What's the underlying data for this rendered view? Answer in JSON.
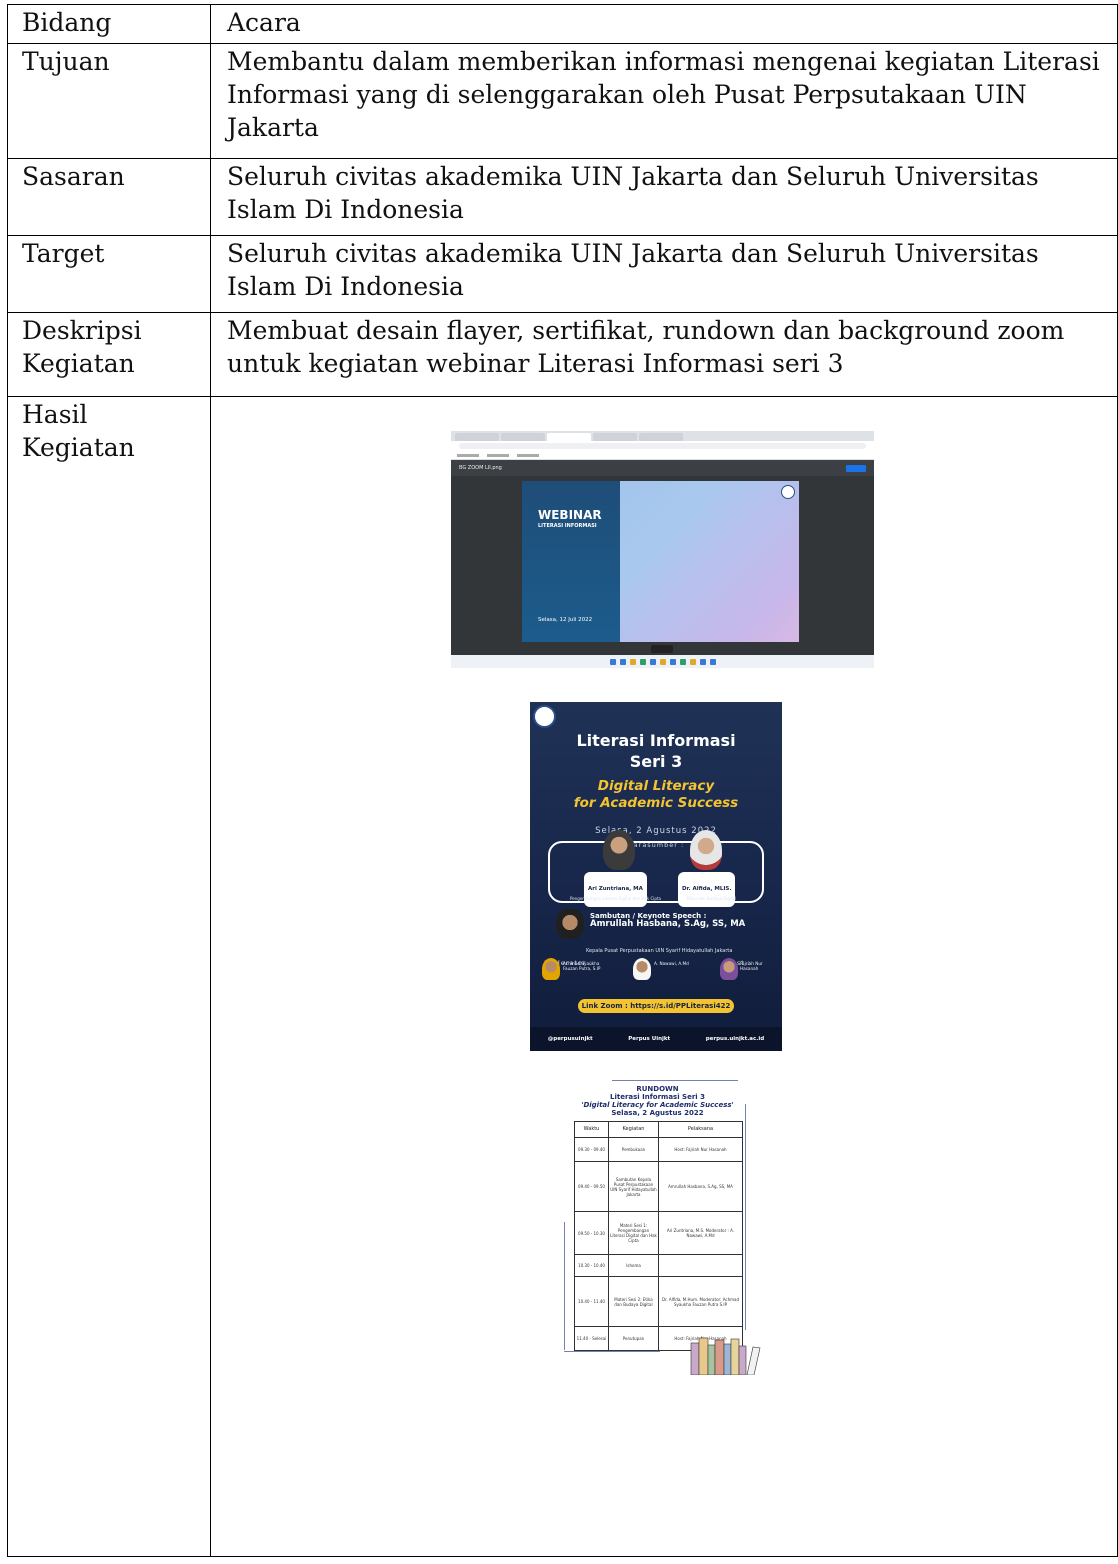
{
  "rows": [
    {
      "label": "Bidang",
      "value": "Acara"
    },
    {
      "label": "Tujuan",
      "value": "Membantu dalam memberikan informasi mengenai kegiatan Literasi Informasi yang di selenggarakan oleh Pusat Perpsutakaan UIN Jakarta"
    },
    {
      "label": "Sasaran",
      "value": "Seluruh civitas akademika UIN Jakarta dan Seluruh Universitas Islam Di Indonesia"
    },
    {
      "label": "Target",
      "value": "Seluruh civitas akademika UIN Jakarta dan Seluruh Universitas Islam Di Indonesia"
    },
    {
      "label": "Deskripsi Kegiatan",
      "value": "Membuat desain flayer,  sertifikat, rundown dan background zoom untuk kegiatan webinar Literasi Informasi seri 3"
    },
    {
      "label": "Hasil Kegiatan",
      "value": ""
    }
  ],
  "screenshot": {
    "file_name": "BG ZOOM LII.png",
    "slide_title": "WEBINAR",
    "slide_subtitle": "LITERASI INFORMASI",
    "slide_date": "Selasa, 12 Juli 2022"
  },
  "poster": {
    "title_line1": "Literasi Informasi",
    "title_line2": "Seri 3",
    "theme_line1": "Digital Literacy",
    "theme_line2": "for Academic Success",
    "date": "Selasa, 2 Agustus 2022",
    "narasumber_label": "Narasumber :",
    "speaker1_name": "Ari Zuntriana, MA",
    "speaker1_role": "Pengembangan Literasi Digital dan Hak Cipta",
    "speaker2_name": "Dr. Alfida, MLIS.",
    "speaker2_role": "Etika dan Budaya Digital",
    "keynote_label": "Sambutan / Keynote Speech :",
    "keynote_name": "Amrullah Hasbana, S.Ag, SS, MA",
    "keynote_role": "Kepala Pusat Perpustakaan UIN Syarif Hidayatullah Jakarta",
    "moderator_label": "Moderator :",
    "host_label": "Host :",
    "moderator1": "Achmad Syaukha Fauzan Putra, S.IP",
    "moderator2": "A. Nawawi, A.Md",
    "host": "Fajriah Nur Hasanah",
    "zoom_link": "Link Zoom : https://s.id/PPLiterasi422",
    "social_handle": "@perpusuinjkt",
    "facebook": "Perpus Uinjkt",
    "website": "perpus.uinjkt.ac.id"
  },
  "rundown": {
    "heading": "RUNDOWN",
    "title": "Literasi Informasi Seri 3",
    "theme": "'Digital Literacy for Academic Success'",
    "date": "Selasa, 2 Agustus 2022",
    "columns": [
      "Waktu",
      "Kegiatan",
      "Pelaksana"
    ],
    "rows": [
      [
        "09.30 - 09.40",
        "Pembukaan",
        "Host: Fajriah Nur Hasanah"
      ],
      [
        "09.40 - 09.50",
        "Sambutan Kepala Pusat Perpustakaan UIN Syarif Hidayatullah Jakarta",
        "Amrullah Hasbana, S.Ag, SS, MA"
      ],
      [
        "09.50 - 10.30",
        "Materi Sesi 1: Pengembangan Literasi Digital dan Hak Cipta",
        "Ari Zuntriana, M.S. Moderator : A. Nawawi, A.Md"
      ],
      [
        "10.30 - 10.40",
        "Ishoma",
        ""
      ],
      [
        "10.40 - 11.40",
        "Materi Sesi 2: Etika dan Budaya Digital",
        "Dr. Alfida, M.Hum. Moderator: Achmad Syaukha Fauzan Putra S.IP"
      ],
      [
        "11.40 - Selesai",
        "Penutupan",
        "Host: Fajriah Nur Hasanah"
      ]
    ]
  }
}
